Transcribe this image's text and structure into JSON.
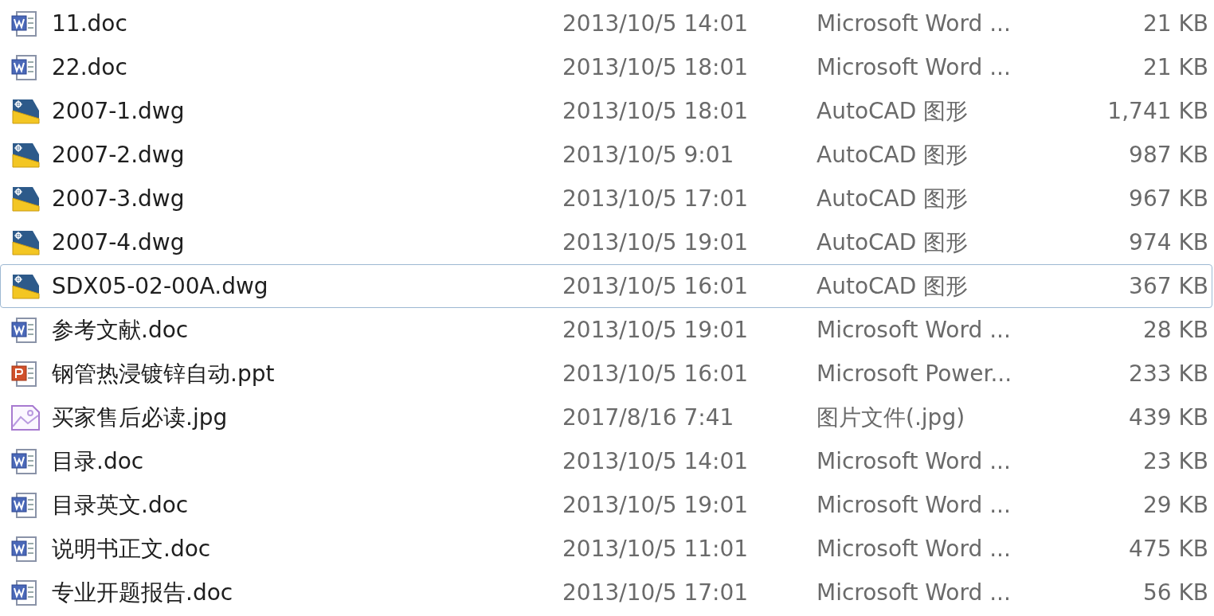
{
  "files": [
    {
      "kind": "doc",
      "name": "11.doc",
      "modified": "2013/10/5 14:01",
      "type": "Microsoft Word ...",
      "size": "21 KB",
      "focused": false
    },
    {
      "kind": "doc",
      "name": "22.doc",
      "modified": "2013/10/5 18:01",
      "type": "Microsoft Word ...",
      "size": "21 KB",
      "focused": false
    },
    {
      "kind": "dwg",
      "name": "2007-1.dwg",
      "modified": "2013/10/5 18:01",
      "type": "AutoCAD 图形",
      "size": "1,741 KB",
      "focused": false
    },
    {
      "kind": "dwg",
      "name": "2007-2.dwg",
      "modified": "2013/10/5 9:01",
      "type": "AutoCAD 图形",
      "size": "987 KB",
      "focused": false
    },
    {
      "kind": "dwg",
      "name": "2007-3.dwg",
      "modified": "2013/10/5 17:01",
      "type": "AutoCAD 图形",
      "size": "967 KB",
      "focused": false
    },
    {
      "kind": "dwg",
      "name": "2007-4.dwg",
      "modified": "2013/10/5 19:01",
      "type": "AutoCAD 图形",
      "size": "974 KB",
      "focused": false
    },
    {
      "kind": "dwg",
      "name": "SDX05-02-00A.dwg",
      "modified": "2013/10/5 16:01",
      "type": "AutoCAD 图形",
      "size": "367 KB",
      "focused": true
    },
    {
      "kind": "doc",
      "name": "参考文献.doc",
      "modified": "2013/10/5 19:01",
      "type": "Microsoft Word ...",
      "size": "28 KB",
      "focused": false
    },
    {
      "kind": "ppt",
      "name": "钢管热浸镀锌自动.ppt",
      "modified": "2013/10/5 16:01",
      "type": "Microsoft Power...",
      "size": "233 KB",
      "focused": false
    },
    {
      "kind": "jpg",
      "name": "买家售后必读.jpg",
      "modified": "2017/8/16 7:41",
      "type": "图片文件(.jpg)",
      "size": "439 KB",
      "focused": false
    },
    {
      "kind": "doc",
      "name": "目录.doc",
      "modified": "2013/10/5 14:01",
      "type": "Microsoft Word ...",
      "size": "23 KB",
      "focused": false
    },
    {
      "kind": "doc",
      "name": "目录英文.doc",
      "modified": "2013/10/5 19:01",
      "type": "Microsoft Word ...",
      "size": "29 KB",
      "focused": false
    },
    {
      "kind": "doc",
      "name": "说明书正文.doc",
      "modified": "2013/10/5 11:01",
      "type": "Microsoft Word ...",
      "size": "475 KB",
      "focused": false
    },
    {
      "kind": "doc",
      "name": "专业开题报告.doc",
      "modified": "2013/10/5 17:01",
      "type": "Microsoft Word ...",
      "size": "56 KB",
      "focused": false
    }
  ]
}
